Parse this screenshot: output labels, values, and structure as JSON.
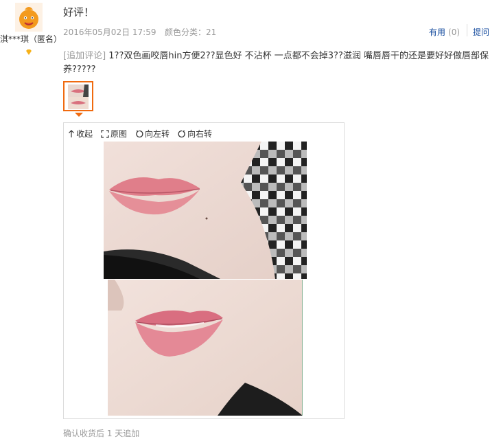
{
  "reviewer": {
    "name": "淇***琪（匿名）",
    "avatar_icon": "avatar-mascot-icon",
    "level_icon": "vip-diamond-icon",
    "accent": "#f39a1e"
  },
  "review": {
    "title": "好评！",
    "date": "2016年05月02日 17:59",
    "sku": "颜色分类：21",
    "helpful_label": "有用",
    "helpful_count": "(0)",
    "ask_label": "提问"
  },
  "append": {
    "tag": "[追加评论]",
    "text": " 1??双色画咬唇hin方便2??显色好 不沾杯 一点都不会掉3??滋润 嘴唇唇干的还是要好好做唇部保养?????"
  },
  "viewer": {
    "collapse_label": "收起",
    "original_label": "原图",
    "rotate_left_label": "向左转",
    "rotate_right_label": "向右转"
  },
  "footer": {
    "partial_text": "确认收货后 1 天追加"
  },
  "colors": {
    "link": "#1a4fa0",
    "meta": "#999999",
    "thumb_border": "#f06a0f"
  }
}
